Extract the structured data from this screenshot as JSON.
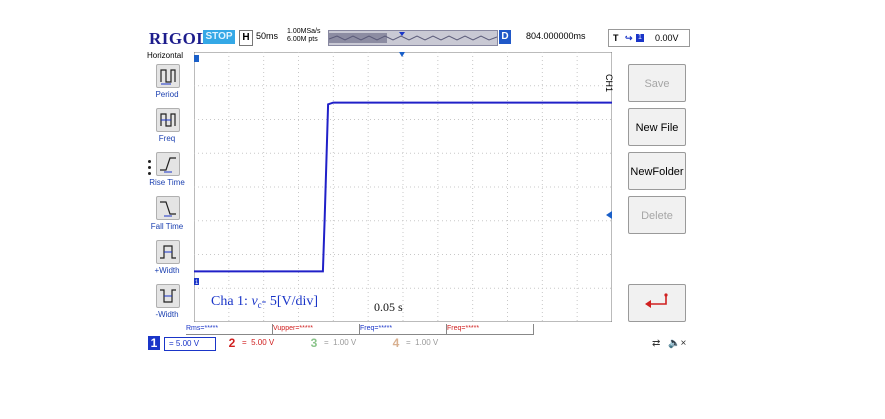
{
  "brand": "RIGOL",
  "status": "STOP",
  "timebase": {
    "label": "H",
    "value": "50ms"
  },
  "sample_rate": [
    "1.00MSa/s",
    "6.00M pts"
  ],
  "delay": {
    "label": "D",
    "value": "804.000000ms"
  },
  "trigger": {
    "label": "T",
    "channel_icon": "1",
    "level": "0.00V"
  },
  "left_menu": {
    "title": "Horizontal",
    "items": [
      {
        "label": "Period",
        "icon": "period-icon"
      },
      {
        "label": "Freq",
        "icon": "freq-icon"
      },
      {
        "label": "Rise Time",
        "icon": "rise-time-icon"
      },
      {
        "label": "Fall Time",
        "icon": "fall-time-icon"
      },
      {
        "label": "+Width",
        "icon": "plus-width-icon"
      },
      {
        "label": "-Width",
        "icon": "minus-width-icon"
      }
    ]
  },
  "side_label": "CH1",
  "softkeys": [
    {
      "label": "Save",
      "enabled": false
    },
    {
      "label": "New File",
      "enabled": true
    },
    {
      "label": "NewFolder",
      "enabled": true
    },
    {
      "label": "Delete",
      "enabled": false
    }
  ],
  "return_icon": "return-arrow-icon",
  "annotation": {
    "prefix": "Cha 1: ",
    "var": "v",
    "sub": "c",
    "suffix": "- 5[V/div]"
  },
  "time_annotation": "0.05 s",
  "measurements": [
    "Rms=*****",
    "Vupper=*****",
    "Freq=*****",
    "Freq=*****"
  ],
  "channels": [
    {
      "num": "1",
      "value": "5.00 V",
      "color": "#1a35c8",
      "active": true
    },
    {
      "num": "2",
      "value": "5.00 V",
      "color": "#d02020",
      "active": false
    },
    {
      "num": "3",
      "value": "1.00 V",
      "color": "#8ac48a",
      "active": false
    },
    {
      "num": "4",
      "value": "1.00 V",
      "color": "#d8b090",
      "active": false
    }
  ],
  "colors": {
    "trace": "#2020c8",
    "brand": "#1c1c8c",
    "stop": "#34a8e6"
  },
  "chart_data": {
    "type": "line",
    "series": [
      {
        "x": [
          0,
          3.7,
          3.75,
          3.85,
          4.0,
          12
        ],
        "y": [
          -5.0,
          -5.0,
          -2.0,
          4.9,
          5.0,
          5.0
        ]
      }
    ],
    "xlim": [
      0,
      12
    ],
    "ylim": [
      -8,
      8
    ],
    "grid": true
  }
}
